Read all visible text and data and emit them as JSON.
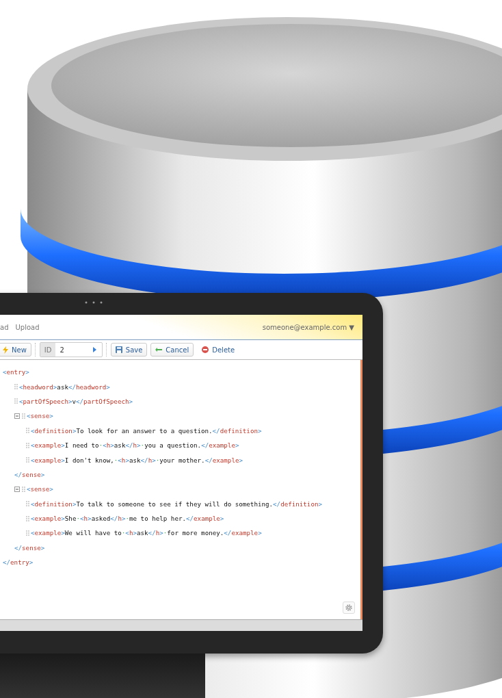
{
  "menu": [
    {
      "label": "ad"
    },
    {
      "label": "Upload"
    }
  ],
  "user": {
    "email": "someone@example.com",
    "caret": "▼"
  },
  "toolbar": {
    "new_label": "New",
    "id_label": "ID",
    "id_value": "2",
    "save_label": "Save",
    "cancel_label": "Cancel",
    "delete_label": "Delete"
  },
  "xml": {
    "open": "<entry>",
    "close": "</entry>",
    "children": [
      {
        "open": "<headword>",
        "close": "</headword>",
        "content": [
          {
            "kind": "text",
            "text": "ask"
          }
        ]
      },
      {
        "open": "<partOfSpeech>",
        "close": "</partOfSpeech>",
        "content": [
          {
            "kind": "text",
            "text": "v"
          }
        ]
      },
      {
        "open": "<sense>",
        "close": "</sense>",
        "expanded": true,
        "children": [
          {
            "open": "<definition>",
            "close": "</definition>",
            "content": [
              {
                "kind": "text",
                "text": "To look for an answer to a question."
              }
            ]
          },
          {
            "open": "<example>",
            "close": "</example>",
            "content": [
              {
                "kind": "text",
                "text": "I need to"
              },
              {
                "kind": "space",
                "text": "·"
              },
              {
                "kind": "tag",
                "open": "<h>",
                "text": "ask",
                "close": "</h>"
              },
              {
                "kind": "space",
                "text": "·"
              },
              {
                "kind": "text",
                "text": "you a question."
              }
            ]
          },
          {
            "open": "<example>",
            "close": "</example>",
            "content": [
              {
                "kind": "text",
                "text": "I don't know,"
              },
              {
                "kind": "space",
                "text": "·"
              },
              {
                "kind": "tag",
                "open": "<h>",
                "text": "ask",
                "close": "</h>"
              },
              {
                "kind": "space",
                "text": "·"
              },
              {
                "kind": "text",
                "text": "your mother."
              }
            ]
          }
        ]
      },
      {
        "open": "<sense>",
        "close": "</sense>",
        "expanded": true,
        "children": [
          {
            "open": "<definition>",
            "close": "</definition>",
            "content": [
              {
                "kind": "text",
                "text": "To talk to someone to see if they will do something."
              }
            ]
          },
          {
            "open": "<example>",
            "close": "</example>",
            "content": [
              {
                "kind": "text",
                "text": "She"
              },
              {
                "kind": "space",
                "text": "·"
              },
              {
                "kind": "tag",
                "open": "<h>",
                "text": "asked",
                "close": "</h>"
              },
              {
                "kind": "space",
                "text": "·"
              },
              {
                "kind": "text",
                "text": "me to help her."
              }
            ]
          },
          {
            "open": "<example>",
            "close": "</example>",
            "content": [
              {
                "kind": "text",
                "text": "We will have to"
              },
              {
                "kind": "space",
                "text": "·"
              },
              {
                "kind": "tag",
                "open": "<h>",
                "text": "ask",
                "close": "</h>"
              },
              {
                "kind": "space",
                "text": "·"
              },
              {
                "kind": "text",
                "text": "for more money."
              }
            ]
          }
        ]
      }
    ]
  }
}
